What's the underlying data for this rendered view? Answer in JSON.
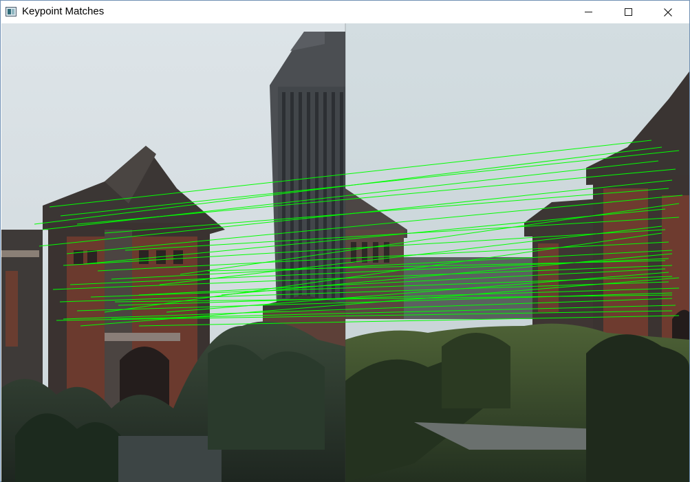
{
  "window": {
    "title": "Keypoint Matches",
    "controls": {
      "minimize": "minimize-icon",
      "maximize": "maximize-icon",
      "close": "close-icon"
    }
  },
  "colors": {
    "match_line": "#00ff00",
    "titlebar_bg": "#ffffff",
    "window_border": "#6f8fb3"
  }
}
